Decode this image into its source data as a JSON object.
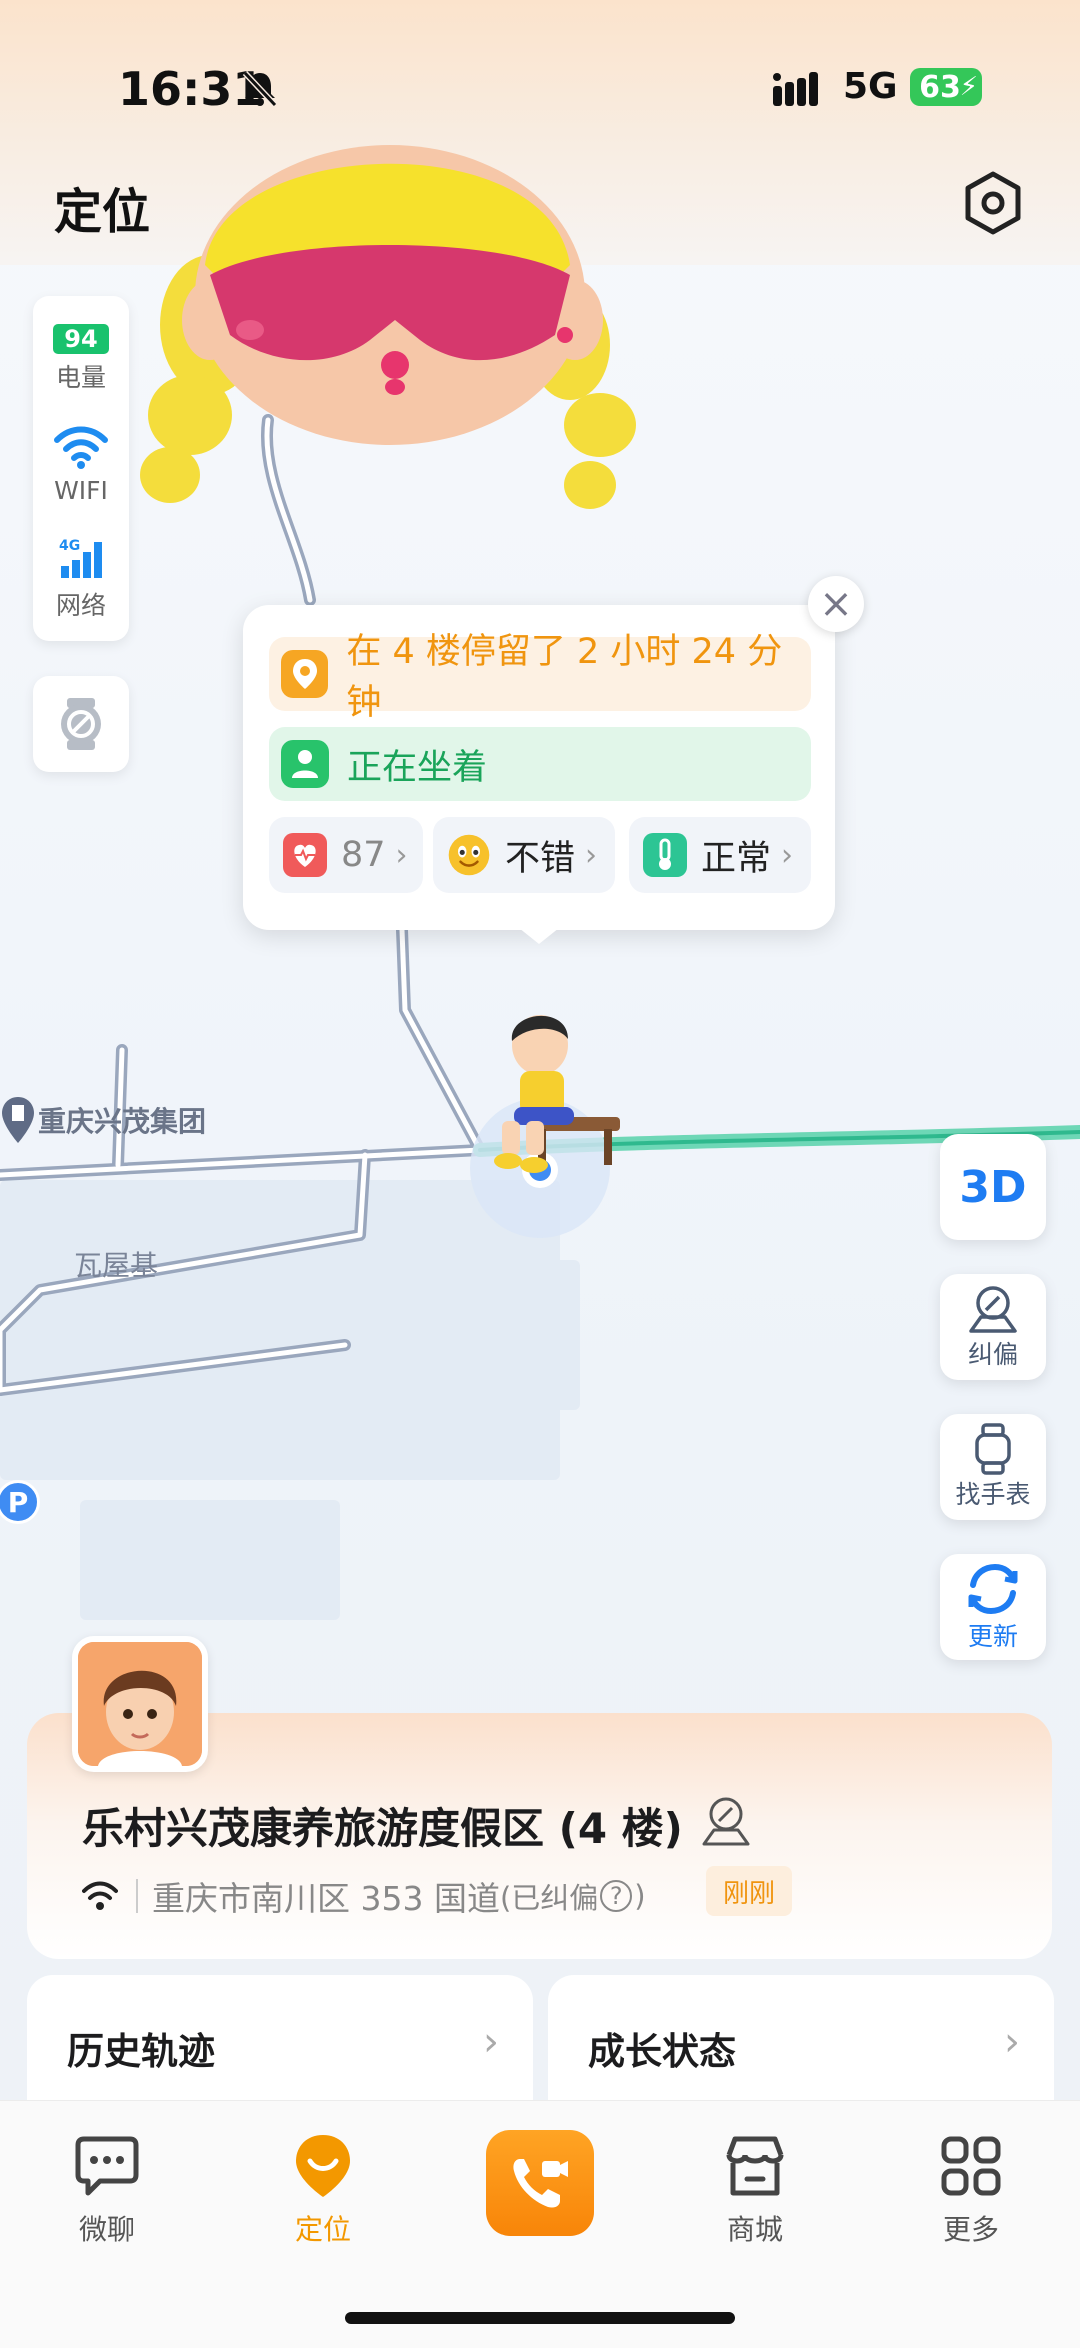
{
  "status_bar": {
    "time": "16:31",
    "network": "5G",
    "battery": "63"
  },
  "header": {
    "title": "定位"
  },
  "device_status": {
    "battery_value": "94",
    "battery_label": "电量",
    "wifi_label": "WIFI",
    "network_type": "4G",
    "network_label": "网络"
  },
  "popup": {
    "stay_text": "在 4 楼停留了 2 小时 24 分钟",
    "activity_text": "正在坐着",
    "heart_rate": "87",
    "mood": "不错",
    "temperature": "正常"
  },
  "map": {
    "poi_name": "重庆兴茂集团",
    "place_name": "瓦屋基",
    "parking_symbol": "P"
  },
  "side_buttons": {
    "view_3d": "3D",
    "correct_label": "纠偏",
    "find_watch_label": "找手表",
    "refresh_label": "更新"
  },
  "location_card": {
    "title": "乐村兴茂康养旅游度假区 (4 楼)",
    "address": "重庆市南川区 353 国道",
    "corrected_note": "(已纠偏",
    "corrected_note_end": ")",
    "help_symbol": "?",
    "time_badge": "刚刚"
  },
  "cards": {
    "history": "历史轨迹",
    "growth": "成长状态"
  },
  "tabs": {
    "chat": "微聊",
    "location": "定位",
    "shop": "商城",
    "more": "更多"
  },
  "colors": {
    "accent_orange": "#f39800",
    "accent_blue": "#1e7cf2",
    "green": "#28c36b"
  }
}
